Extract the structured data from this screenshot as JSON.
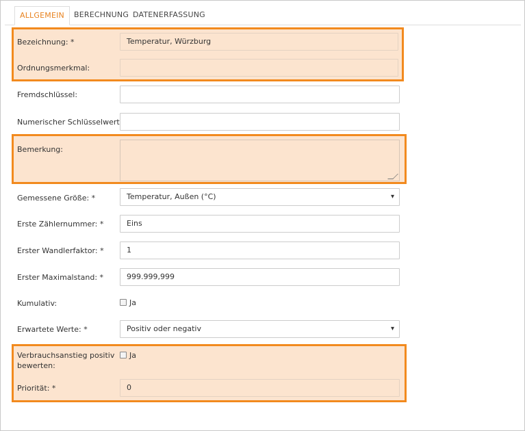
{
  "tabs": [
    {
      "label": "ALLGEMEIN",
      "active": true
    },
    {
      "label": "BERECHNUNG",
      "active": false
    },
    {
      "label": "DATENERFASSUNG",
      "active": false
    }
  ],
  "form": {
    "bezeichnung": {
      "label": "Bezeichnung: *",
      "value": "Temperatur, Würzburg"
    },
    "ordnungsmerkmal": {
      "label": "Ordnungsmerkmal:",
      "value": ""
    },
    "fremdschluessel": {
      "label": "Fremdschlüssel:",
      "value": ""
    },
    "numerischer_schluesselwert": {
      "label": "Numerischer Schlüsselwert:",
      "value": ""
    },
    "bemerkung": {
      "label": "Bemerkung:",
      "value": ""
    },
    "gemessene_groesse": {
      "label": "Gemessene Größe: *",
      "value": "Temperatur, Außen (°C)"
    },
    "erste_zaehlernummer": {
      "label": "Erste Zählernummer: *",
      "value": "Eins"
    },
    "erster_wandlerfaktor": {
      "label": "Erster Wandlerfaktor: *",
      "value": "1"
    },
    "erster_maximalstand": {
      "label": "Erster Maximalstand: *",
      "value": "999.999,999"
    },
    "kumulativ": {
      "label": "Kumulativ:",
      "option": "Ja",
      "checked": false
    },
    "erwartete_werte": {
      "label": "Erwartete Werte: *",
      "value": "Positiv oder negativ"
    },
    "verbrauchsanstieg": {
      "label_line1": "Verbrauchsanstieg positiv",
      "label_line2": "bewerten:",
      "option": "Ja",
      "checked": false
    },
    "prioritaet": {
      "label": "Priorität: *",
      "value": "0"
    }
  },
  "colors": {
    "highlight_border": "#f28a1e",
    "highlight_fill": "#fce4cf",
    "active_tab_text": "#e8821e"
  }
}
